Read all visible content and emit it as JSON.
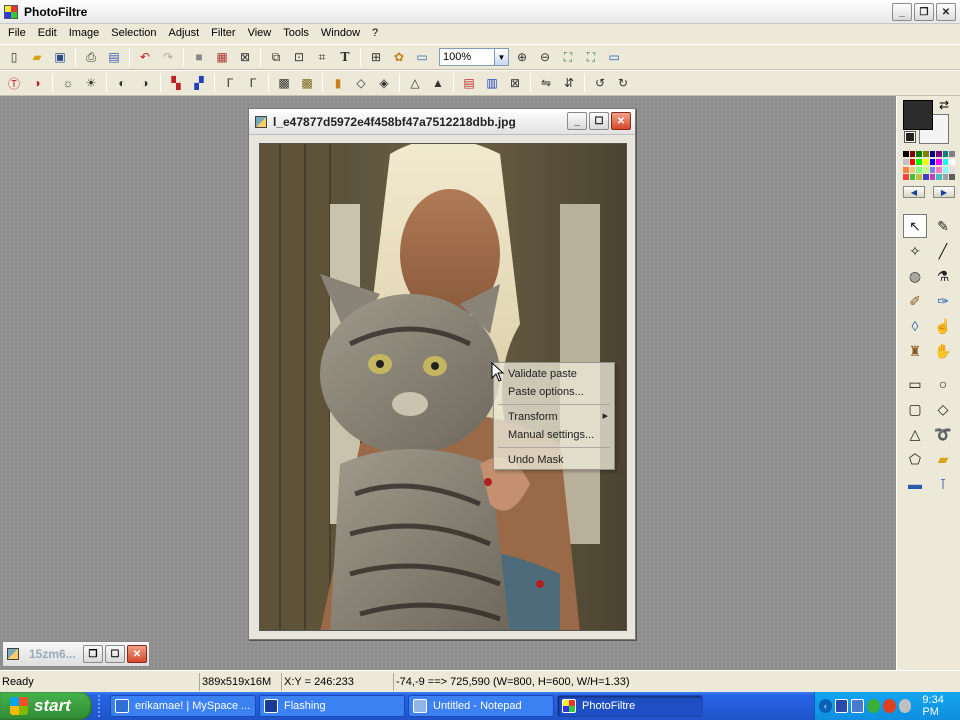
{
  "app": {
    "title": "PhotoFiltre"
  },
  "menu": [
    "File",
    "Edit",
    "Image",
    "Selection",
    "Adjust",
    "Filter",
    "View",
    "Tools",
    "Window",
    "?"
  ],
  "toolbar": {
    "zoom_value": "100%"
  },
  "image_window": {
    "title": "l_e47877d5972e4f458bf47a7512218dbb.jpg"
  },
  "context_menu": {
    "items": [
      "Validate paste",
      "Paste options...",
      "Transform",
      "Manual settings...",
      "Undo Mask"
    ]
  },
  "minimized_window": {
    "title": "15zm6..."
  },
  "status": {
    "ready": "Ready",
    "image_info": "389x519x16M",
    "cursor": "X:Y = 246:233",
    "selection": "-74,-9 ==> 725,590 (W=800, H=600, W/H=1.33)"
  },
  "taskbar": {
    "start_label": "start",
    "tasks": [
      {
        "label": "erikamae! | MySpace ...",
        "icon_color": "#2e6fd6"
      },
      {
        "label": "Flashing",
        "icon_color": "#1a3a9a"
      },
      {
        "label": "Untitled - Notepad",
        "icon_color": "#8fb6e6"
      },
      {
        "label": "PhotoFiltre",
        "icon_color": "#c83"
      }
    ],
    "clock": "9:34 PM"
  },
  "colors": {
    "foreground": "#2b2b2b",
    "background": "#f4f4f4",
    "workspace": "#8e8e8e",
    "taskbar": "#245edb"
  }
}
